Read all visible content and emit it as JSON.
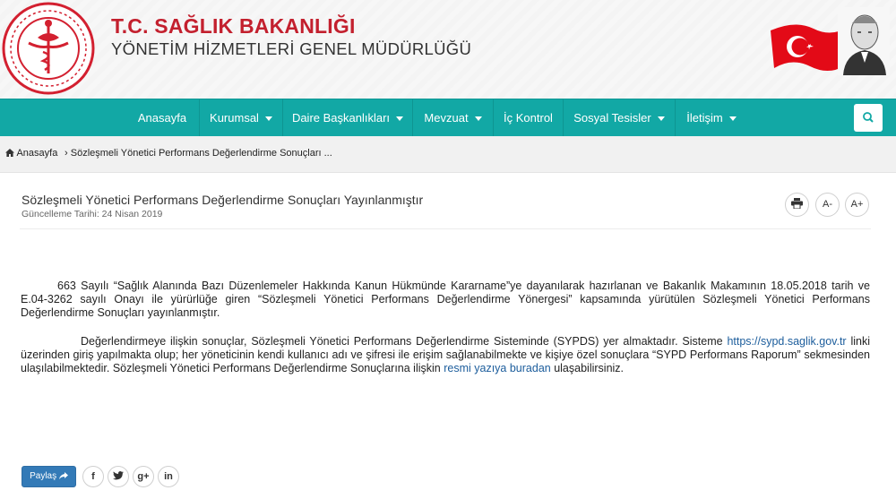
{
  "header": {
    "title": "T.C. SAĞLIK BAKANLIĞI",
    "subtitle": "YÖNETİM HİZMETLERİ GENEL MÜDÜRLÜĞÜ",
    "logo_icon": "ministry-seal-icon",
    "flag_icon": "turkish-flag-icon",
    "portrait_icon": "ataturk-portrait-icon"
  },
  "nav": {
    "items": [
      {
        "label": "Anasayfa",
        "dropdown": false
      },
      {
        "label": "Kurumsal",
        "dropdown": true
      },
      {
        "label": "Daire Başkanlıkları",
        "dropdown": true
      },
      {
        "label": "Mevzuat",
        "dropdown": true
      },
      {
        "label": "İç Kontrol",
        "dropdown": false
      },
      {
        "label": "Sosyal Tesisler",
        "dropdown": true
      },
      {
        "label": "İletişim",
        "dropdown": true
      }
    ],
    "search_icon": "search-icon"
  },
  "breadcrumb": {
    "home": "Anasayfa",
    "current": "Sözleşmeli Yönetici Performans Değerlendirme Sonuçları ..."
  },
  "article": {
    "title": "Sözleşmeli Yönetici Performans Değerlendirme Sonuçları Yayınlanmıştır",
    "date": "Güncelleme Tarihi: 24 Nisan 2019",
    "tools": {
      "print_icon": "print-icon",
      "font_decrease": "A-",
      "font_increase": "A+"
    },
    "p1": "663 Sayılı “Sağlık Alanında Bazı Düzenlemeler Hakkında Kanun Hükmünde Kararname”ye dayanılarak hazırlanan ve Bakanlık Makamının 18.05.2018 tarih ve E.04-3262 sayılı Onayı ile yürürlüğe giren “Sözleşmeli Yönetici Performans Değerlendirme Yönergesi” kapsamında yürütülen Sözleşmeli Yönetici Performans Değerlendirme Sonuçları yayınlanmıştır.",
    "p2_a": "Değerlendirmeye ilişkin sonuçlar, Sözleşmeli Yönetici Performans Değerlendirme Sisteminde (SYPDS) yer almaktadır. Sisteme ",
    "p2_link": "https://sypd.saglik.gov.tr",
    "p2_b": " linki üzerinden giriş yapılmakta olup; her yöneticinin kendi kullanıcı adı ve şifresi ile erişim sağlanabilmekte ve kişiye özel sonuçlara “SYPD Performans Raporum” sekmesinden ulaşılabilmektedir. Sözleşmeli Yönetici Performans Değerlendirme Sonuçlarına ilişkin ",
    "p2_link2": "resmi yazıya buradan",
    "p2_c": " ulaşabilirsiniz."
  },
  "share": {
    "label": "Paylaş",
    "facebook": "f",
    "twitter_icon": "twitter-icon",
    "gplus": "g+",
    "linkedin": "in"
  }
}
